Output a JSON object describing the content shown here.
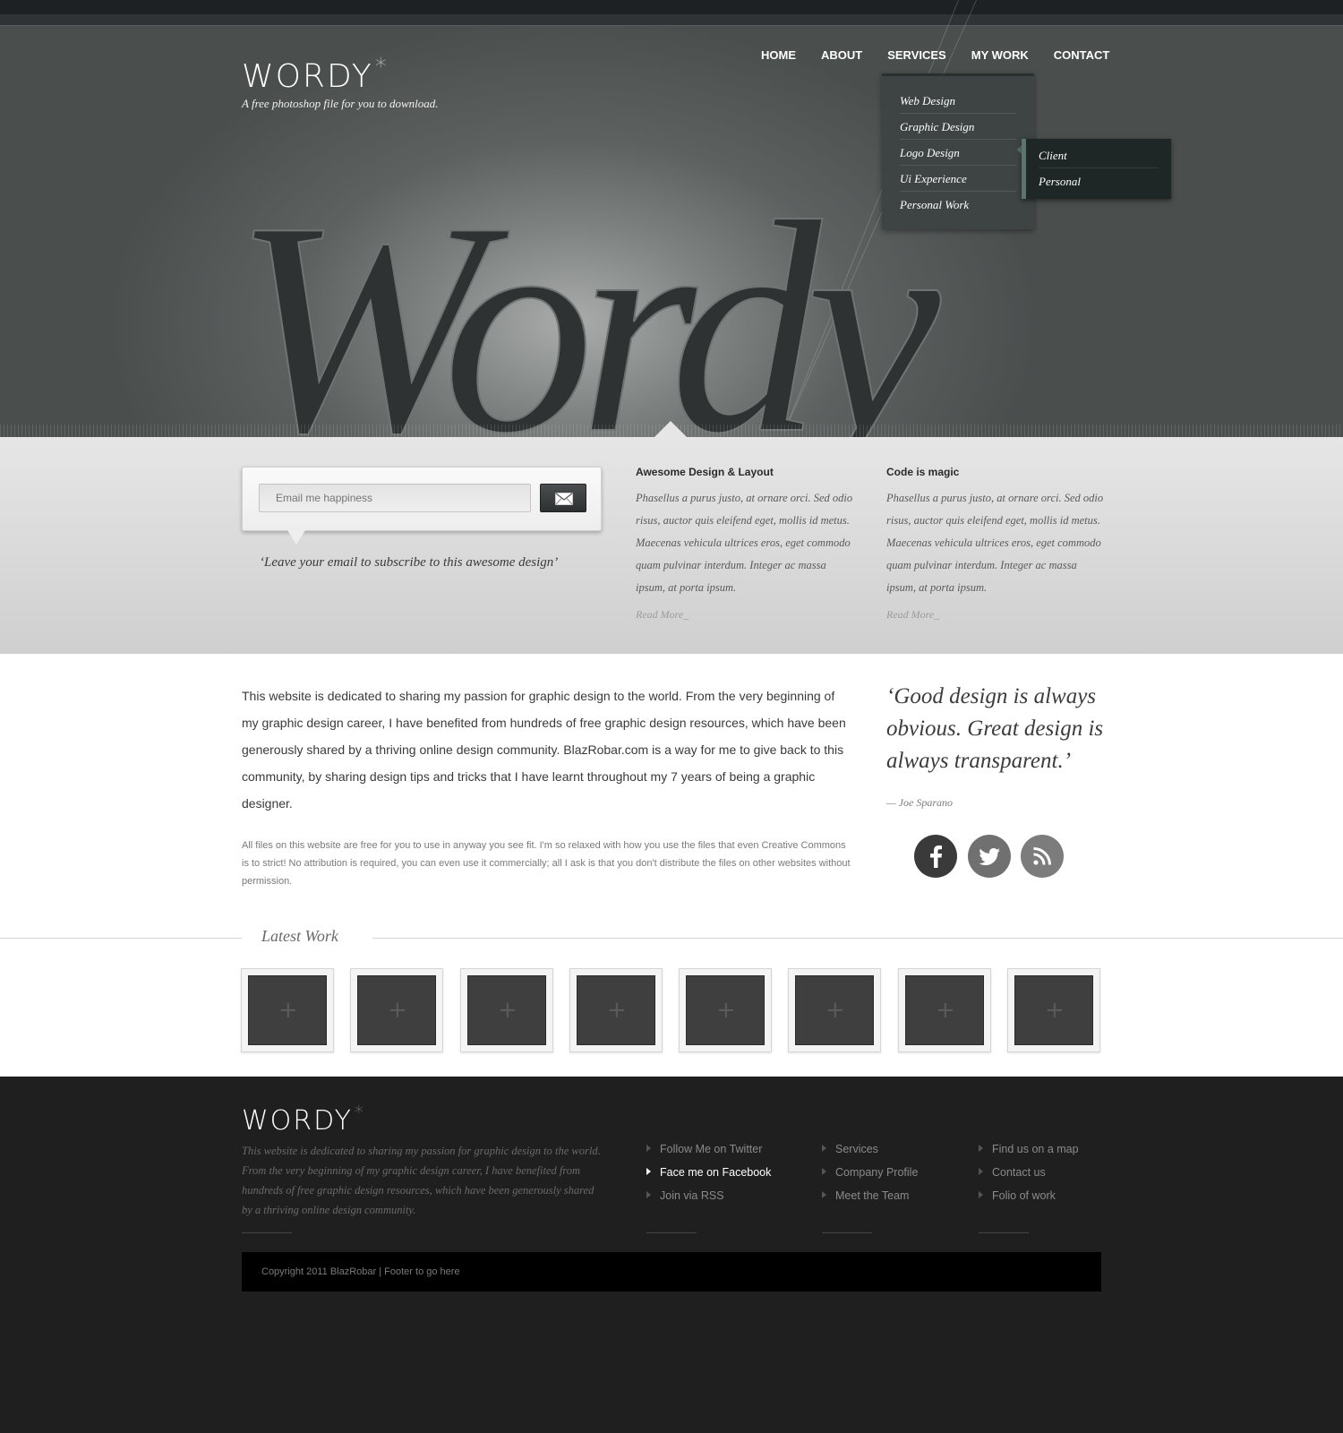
{
  "header": {
    "logo_text": "WORDY",
    "logo_star": "*",
    "tagline": "A free photoshop file for you to download.",
    "hero_script": "Wordy"
  },
  "nav": {
    "items": [
      {
        "label": "HOME"
      },
      {
        "label": "ABOUT"
      },
      {
        "label": "SERVICES"
      },
      {
        "label": "MY WORK"
      },
      {
        "label": "CONTACT"
      }
    ]
  },
  "services_menu": {
    "items": [
      {
        "label": "Web Design"
      },
      {
        "label": "Graphic Design"
      },
      {
        "label": "Logo Design"
      },
      {
        "label": "Ui Experience"
      },
      {
        "label": "Personal Work"
      }
    ],
    "submenu": [
      {
        "label": "Client"
      },
      {
        "label": "Personal"
      }
    ]
  },
  "subscribe": {
    "placeholder": "Email me happiness",
    "button_icon": "envelope-icon",
    "note": "‘Leave your email to subscribe to this awesome design’"
  },
  "features": [
    {
      "title": "Awesome Design & Layout",
      "body": "Phasellus a purus justo, at ornare orci. Sed odio risus, auctor quis eleifend eget, mollis id metus. Maecenas vehicula ultrices eros, eget commodo quam pulvinar interdum. Integer ac massa ipsum, at porta ipsum.",
      "read_more": "Read More_"
    },
    {
      "title": "Code is magic",
      "body": "Phasellus a purus justo, at ornare orci. Sed odio risus, auctor quis eleifend eget, mollis id metus. Maecenas vehicula ultrices eros, eget commodo quam pulvinar interdum. Integer ac massa ipsum, at porta ipsum.",
      "read_more": "Read More_"
    }
  ],
  "main": {
    "intro": "This website is dedicated to sharing my passion for graphic design to the world. From the very beginning of my graphic design career, I have benefited from hundreds of free graphic design resources, which have been generously shared by a thriving online design community. BlazRobar.com is a way for me to give back to this community, by sharing design tips and tricks that I have learnt throughout my 7 years of being a graphic designer.",
    "note": "All files on this website are free for you to use in anyway you see fit. I'm so relaxed with how you use the files that even Creative Commons is to strict! No attribution is required, you can even use it commercially; all I ask is that you don't distribute the files on other websites without permission.",
    "quote": "‘Good design is always obvious. Great design is always transparent.’",
    "quote_author": "— Joe Sparano",
    "social": [
      {
        "icon": "facebook-icon",
        "color": "#3a3a3a"
      },
      {
        "icon": "twitter-icon",
        "color": "#707070"
      },
      {
        "icon": "rss-icon",
        "color": "#7c7c7c"
      }
    ]
  },
  "latest_work": {
    "title": "Latest Work",
    "items": [
      {
        "icon": "plus-icon"
      },
      {
        "icon": "plus-icon"
      },
      {
        "icon": "plus-icon"
      },
      {
        "icon": "plus-icon"
      },
      {
        "icon": "plus-icon"
      },
      {
        "icon": "plus-icon"
      },
      {
        "icon": "plus-icon"
      },
      {
        "icon": "plus-icon"
      }
    ]
  },
  "footer": {
    "logo_text": "WORDY",
    "logo_star": "*",
    "text": "This website is dedicated to sharing my passion for graphic design to the world. From the very beginning of my graphic design career, I have benefited from hundreds of free graphic design resources, which have been generously shared by a thriving online design community.",
    "columns": [
      [
        {
          "label": "Follow Me on Twitter",
          "active": false
        },
        {
          "label": "Face me on Facebook",
          "active": true
        },
        {
          "label": "Join via RSS",
          "active": false
        }
      ],
      [
        {
          "label": "Services",
          "active": false
        },
        {
          "label": "Company Profile",
          "active": false
        },
        {
          "label": "Meet the Team",
          "active": false
        }
      ],
      [
        {
          "label": "Find us on a map",
          "active": false
        },
        {
          "label": "Contact us",
          "active": false
        },
        {
          "label": "Folio of work",
          "active": false
        }
      ]
    ],
    "copyright": "Copyright 2011 BlazRobar | Footer to go here"
  }
}
